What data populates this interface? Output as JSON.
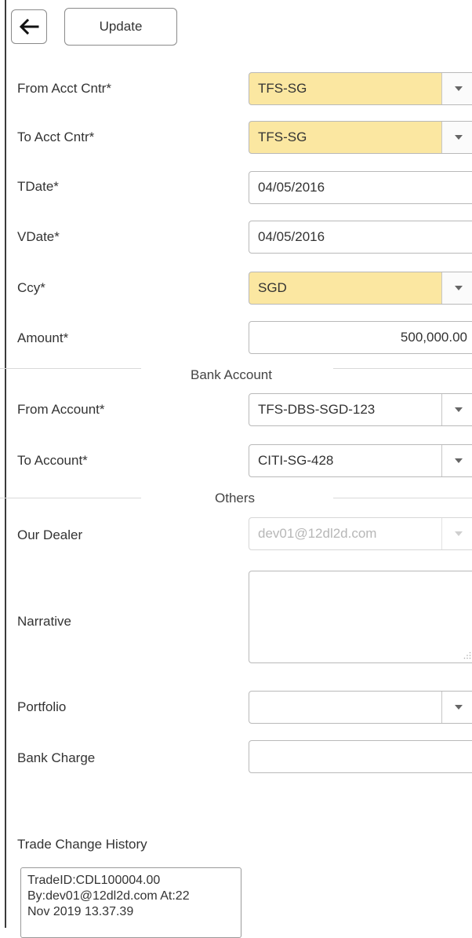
{
  "toolbar": {
    "update_label": "Update"
  },
  "form": {
    "from_acct_cntr": {
      "label": "From Acct Cntr*",
      "value": "TFS-SG"
    },
    "to_acct_cntr": {
      "label": "To Acct Cntr*",
      "value": "TFS-SG"
    },
    "tdate": {
      "label": "TDate*",
      "value": "04/05/2016"
    },
    "vdate": {
      "label": "VDate*",
      "value": "04/05/2016"
    },
    "ccy": {
      "label": "Ccy*",
      "value": "SGD"
    },
    "amount": {
      "label": "Amount*",
      "value": "500,000.00"
    }
  },
  "bank_account": {
    "title": "Bank Account",
    "from_account": {
      "label": "From Account*",
      "value": "TFS-DBS-SGD-123"
    },
    "to_account": {
      "label": "To Account*",
      "value": "CITI-SG-428"
    }
  },
  "others": {
    "title": "Others",
    "our_dealer": {
      "label": "Our Dealer",
      "value": "dev01@12dl2d.com"
    },
    "narrative": {
      "label": "Narrative",
      "value": ""
    },
    "portfolio": {
      "label": "Portfolio",
      "value": ""
    },
    "bank_charge": {
      "label": "Bank Charge",
      "value": ""
    }
  },
  "history": {
    "title": "Trade Change History",
    "lines": [
      "TradeID:CDL100004.00",
      "By:dev01@12dl2d.com At:22",
      "Nov 2019 13.37.39"
    ]
  },
  "colors": {
    "required_highlight": "#fbe7a1",
    "border": "#b9b9b9"
  }
}
